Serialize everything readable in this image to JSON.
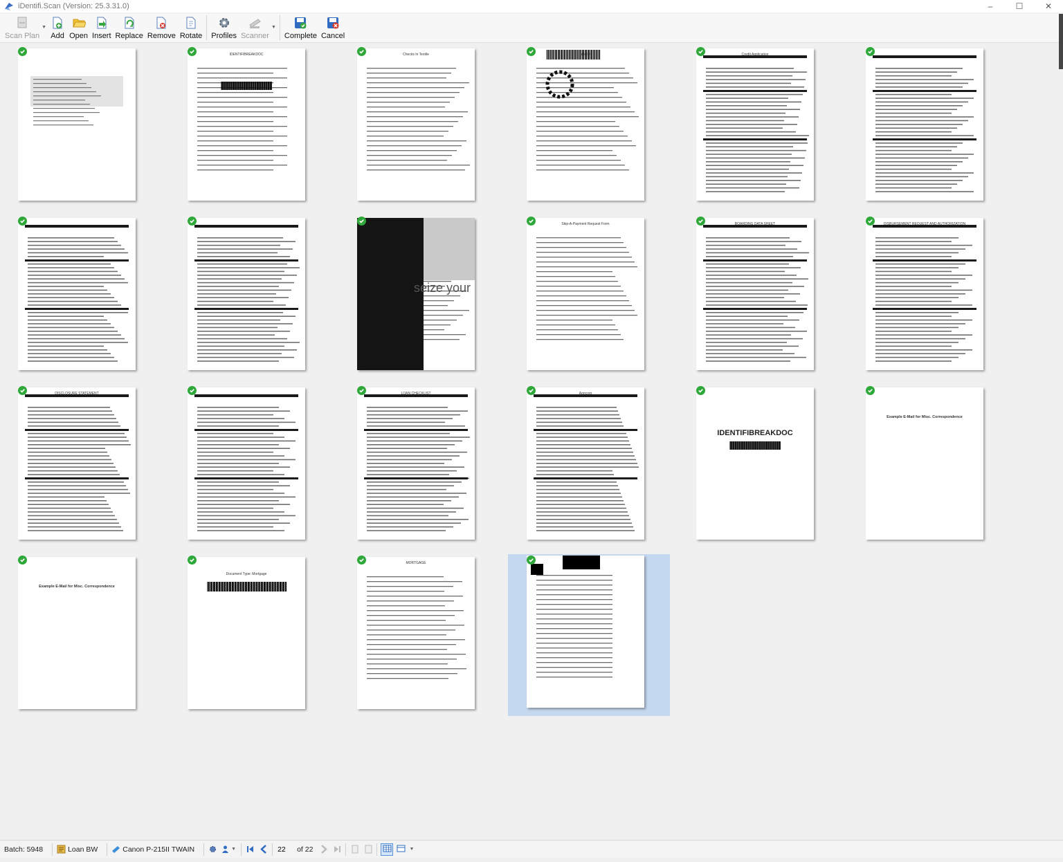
{
  "window": {
    "title": "iDentifi.Scan (Version: 25.3.31.0)"
  },
  "toolbar": {
    "scan_plan": "Scan Plan",
    "add": "Add",
    "open": "Open",
    "insert": "Insert",
    "replace": "Replace",
    "remove": "Remove",
    "rotate": "Rotate",
    "profiles": "Profiles",
    "scanner": "Scanner",
    "complete": "Complete",
    "cancel": "Cancel"
  },
  "pages": [
    {
      "big": "",
      "small": ""
    },
    {
      "big": "",
      "small": "IDENTIFIBREAKDOC"
    },
    {
      "big": "",
      "small": "Checks In Textile"
    },
    {
      "big": "",
      "small": "identifi"
    },
    {
      "big": "",
      "small": "Credit Application"
    },
    {
      "big": "",
      "small": ""
    },
    {
      "big": "",
      "small": ""
    },
    {
      "big": "",
      "small": ""
    },
    {
      "big": "",
      "small": "seize your"
    },
    {
      "big": "",
      "small": "Skip-A-Payment Request Form"
    },
    {
      "big": "",
      "small": "BOARDING DATA SHEET"
    },
    {
      "big": "",
      "small": "DISBURSEMENT REQUEST AND AUTHORIZATION"
    },
    {
      "big": "",
      "small": "DISCLOSURE STATEMENT"
    },
    {
      "big": "",
      "small": ""
    },
    {
      "big": "",
      "small": "LOAN CHECKLIST"
    },
    {
      "big": "",
      "small": "Agricorp"
    },
    {
      "big": "IDENTIFIBREAKDOC",
      "small": ""
    },
    {
      "big": "",
      "small": "Example E-Mail for Misc. Correspondence"
    },
    {
      "big": "",
      "small": "Example E-Mail for Misc. Correspondence"
    },
    {
      "big": "",
      "small": "Document Type: Mortgage"
    },
    {
      "big": "",
      "small": "MORTGAGE"
    },
    {
      "big": "",
      "small": ""
    }
  ],
  "status": {
    "batch": "Batch: 5948",
    "profile": "Loan BW",
    "scanner": "Canon P-215II TWAIN",
    "current_page": "22",
    "of_pages": "of 22"
  }
}
